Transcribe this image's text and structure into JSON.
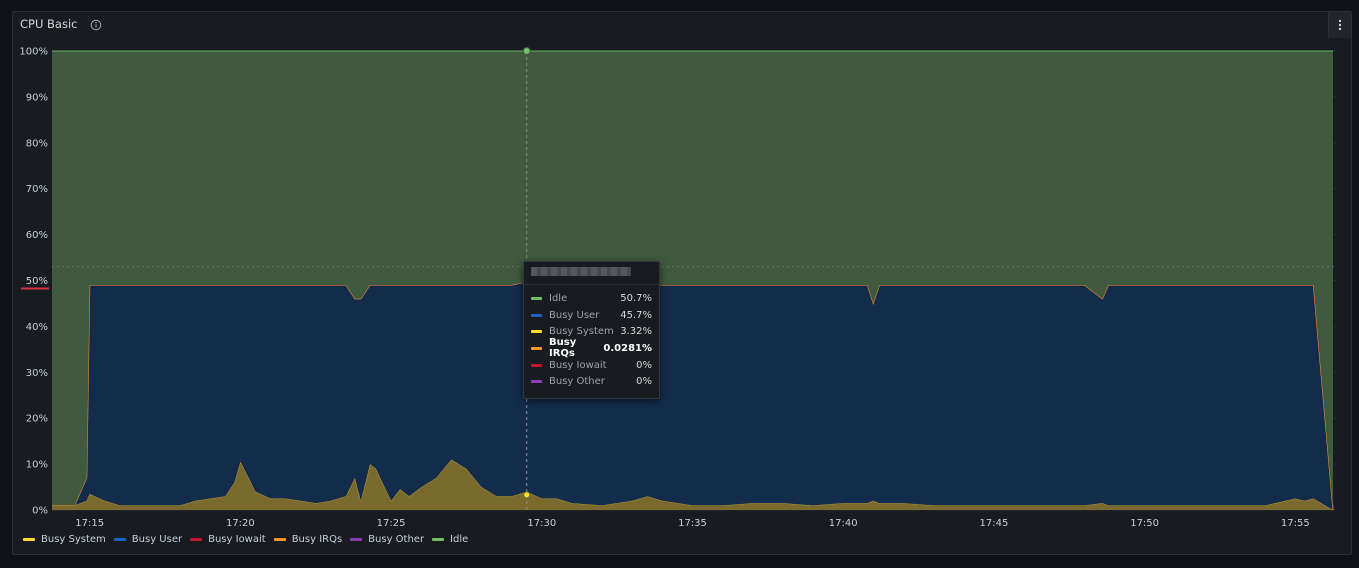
{
  "panel": {
    "title": "CPU Basic",
    "menu_icon": "vertical-ellipsis-icon",
    "info_icon": "info-circle-icon"
  },
  "tooltip": {
    "time": "",
    "rows": [
      {
        "name": "Idle",
        "value": "50.7%",
        "color": "#73bf69",
        "highlight": false
      },
      {
        "name": "Busy User",
        "value": "45.7%",
        "color": "#1f60c4",
        "highlight": false
      },
      {
        "name": "Busy System",
        "value": "3.32%",
        "color": "#fade2a",
        "highlight": false
      },
      {
        "name": "Busy IRQs",
        "value": "0.0281%",
        "color": "#ff9830",
        "highlight": true
      },
      {
        "name": "Busy Iowait",
        "value": "0%",
        "color": "#c4162a",
        "highlight": false
      },
      {
        "name": "Busy Other",
        "value": "0%",
        "color": "#8f3bb8",
        "highlight": false
      }
    ]
  },
  "legend": [
    {
      "name": "Busy System",
      "color": "#fade2a"
    },
    {
      "name": "Busy User",
      "color": "#1f60c4"
    },
    {
      "name": "Busy Iowait",
      "color": "#c4162a"
    },
    {
      "name": "Busy IRQs",
      "color": "#ff9830"
    },
    {
      "name": "Busy Other",
      "color": "#8f3bb8"
    },
    {
      "name": "Idle",
      "color": "#73bf69"
    }
  ],
  "chart_data": {
    "type": "area",
    "stacked": true,
    "title": "CPU Basic",
    "ylim": [
      0,
      100
    ],
    "y_ticks": [
      "0%",
      "10%",
      "20%",
      "30%",
      "40%",
      "50%",
      "60%",
      "70%",
      "80%",
      "90%",
      "100%"
    ],
    "x_ticks": [
      "17:15",
      "17:20",
      "17:25",
      "17:30",
      "17:35",
      "17:40",
      "17:45",
      "17:50",
      "17:55"
    ],
    "x_tick_minutes": [
      15,
      20,
      25,
      30,
      35,
      40,
      45,
      50,
      55
    ],
    "x_range_minutes": [
      13.75,
      56.25
    ],
    "cursor_minute": 29.5,
    "threshold_y": 53,
    "grid": true,
    "legend_position": "bottom-left",
    "x": [
      13.75,
      14.5,
      14.9,
      15.0,
      15.5,
      16,
      17,
      18,
      18.5,
      19,
      19.5,
      19.8,
      20,
      20.2,
      20.5,
      21,
      21.5,
      22,
      22.5,
      23,
      23.5,
      23.8,
      24,
      24.3,
      24.5,
      25,
      25.3,
      25.6,
      26,
      26.5,
      27,
      27.5,
      28,
      28.5,
      29,
      29.5,
      30,
      30.5,
      31,
      32,
      33,
      33.5,
      34,
      35,
      36,
      37,
      38,
      39,
      40,
      40.8,
      41,
      41.2,
      42,
      43,
      44,
      45,
      46,
      47,
      48,
      48.6,
      48.8,
      49,
      50,
      51,
      52,
      53,
      54,
      55,
      55.3,
      55.6,
      56.25
    ],
    "series": [
      {
        "name": "Busy System",
        "color": "#fade2a",
        "values": [
          1,
          1,
          2,
          3.5,
          2,
          1,
          1,
          1,
          2,
          2.5,
          3,
          6,
          10.5,
          8,
          4,
          2.5,
          2.5,
          2,
          1.5,
          2,
          3,
          7,
          2,
          10,
          9,
          2,
          4.5,
          3,
          5,
          7,
          11,
          9,
          5,
          3,
          3,
          4,
          2.5,
          2.5,
          1.5,
          1,
          2,
          3,
          2,
          1,
          1,
          1.5,
          1.5,
          1,
          1.5,
          1.5,
          2,
          1.5,
          1.5,
          1,
          1,
          1,
          1,
          1,
          1,
          1.5,
          1,
          1,
          1,
          1,
          1,
          1,
          1,
          2.5,
          2,
          2.5,
          0
        ]
      },
      {
        "name": "Busy User",
        "color": "#1f60c4",
        "values": [
          0,
          0,
          5,
          45.5,
          47,
          48,
          48,
          48,
          47,
          46.5,
          46,
          43,
          38.5,
          41,
          45,
          46.5,
          46.5,
          47,
          47.5,
          47,
          46,
          39,
          44,
          39,
          40,
          47,
          44.5,
          46,
          44,
          42,
          38,
          40,
          44,
          46,
          46,
          45.7,
          46.5,
          46.5,
          47.5,
          48,
          47,
          46,
          47,
          48,
          48,
          47.5,
          47.5,
          48,
          47.5,
          47.5,
          43,
          47.5,
          47.5,
          48,
          48,
          48,
          48,
          48,
          48,
          44.5,
          48,
          48,
          48,
          48,
          48,
          48,
          48,
          46.5,
          47,
          46.5,
          0
        ]
      },
      {
        "name": "Busy Iowait",
        "color": "#c4162a",
        "values": [
          0,
          0,
          0,
          0,
          0,
          0,
          0,
          0,
          0,
          0,
          0,
          0,
          0,
          0,
          0,
          0,
          0,
          0,
          0,
          0,
          0,
          0,
          0,
          0,
          0,
          0,
          0,
          0,
          0,
          0,
          0,
          0,
          0,
          0,
          0,
          0,
          0,
          0,
          0,
          0,
          0,
          0,
          0,
          0,
          0,
          0,
          0,
          0,
          0,
          0,
          0,
          0,
          0,
          0,
          0,
          0,
          0,
          0,
          0,
          0,
          0,
          0,
          0,
          0,
          0,
          0,
          0,
          0,
          0,
          0,
          0
        ]
      },
      {
        "name": "Busy IRQs",
        "color": "#ff9830",
        "values": [
          0,
          0,
          0,
          0.03,
          0.03,
          0.03,
          0.03,
          0.03,
          0.03,
          0.03,
          0.03,
          0.03,
          0.03,
          0.03,
          0.03,
          0.03,
          0.03,
          0.03,
          0.03,
          0.03,
          0.03,
          0.03,
          0.03,
          0.03,
          0.03,
          0.03,
          0.03,
          0.03,
          0.03,
          0.03,
          0.03,
          0.03,
          0.03,
          0.03,
          0.03,
          0.03,
          0.03,
          0.03,
          0.03,
          0.03,
          0.03,
          0.03,
          0.03,
          0.03,
          0.03,
          0.03,
          0.03,
          0.03,
          0.03,
          0.03,
          0.03,
          0.03,
          0.03,
          0.03,
          0.03,
          0.03,
          0.03,
          0.03,
          0.03,
          0.03,
          0.03,
          0.03,
          0.03,
          0.03,
          0.03,
          0.03,
          0.03,
          0.03,
          0.03,
          0.03,
          0
        ]
      },
      {
        "name": "Busy Other",
        "color": "#8f3bb8",
        "values": [
          0,
          0,
          0,
          0,
          0,
          0,
          0,
          0,
          0,
          0,
          0,
          0,
          0,
          0,
          0,
          0,
          0,
          0,
          0,
          0,
          0,
          0,
          0,
          0,
          0,
          0,
          0,
          0,
          0,
          0,
          0,
          0,
          0,
          0,
          0,
          0,
          0,
          0,
          0,
          0,
          0,
          0,
          0,
          0,
          0,
          0,
          0,
          0,
          0,
          0,
          0,
          0,
          0,
          0,
          0,
          0,
          0,
          0,
          0,
          0,
          0,
          0,
          0,
          0,
          0,
          0,
          0,
          0,
          0,
          0,
          0
        ]
      },
      {
        "name": "Idle",
        "color": "#73bf69",
        "values": [
          99,
          99,
          93,
          51,
          51,
          51,
          51,
          51,
          51,
          51,
          51,
          51,
          51,
          51,
          51,
          51,
          51,
          51,
          51,
          51,
          51,
          54,
          54,
          51,
          51,
          51,
          51,
          51,
          51,
          51,
          51,
          51,
          51,
          51,
          51,
          50.3,
          51,
          51,
          51,
          51,
          51,
          51,
          51,
          51,
          51,
          51,
          51,
          51,
          51,
          51,
          55,
          51,
          51,
          51,
          51,
          51,
          51,
          51,
          51,
          54,
          51,
          51,
          51,
          51,
          51,
          51,
          51,
          51,
          51,
          51,
          100
        ]
      }
    ]
  }
}
